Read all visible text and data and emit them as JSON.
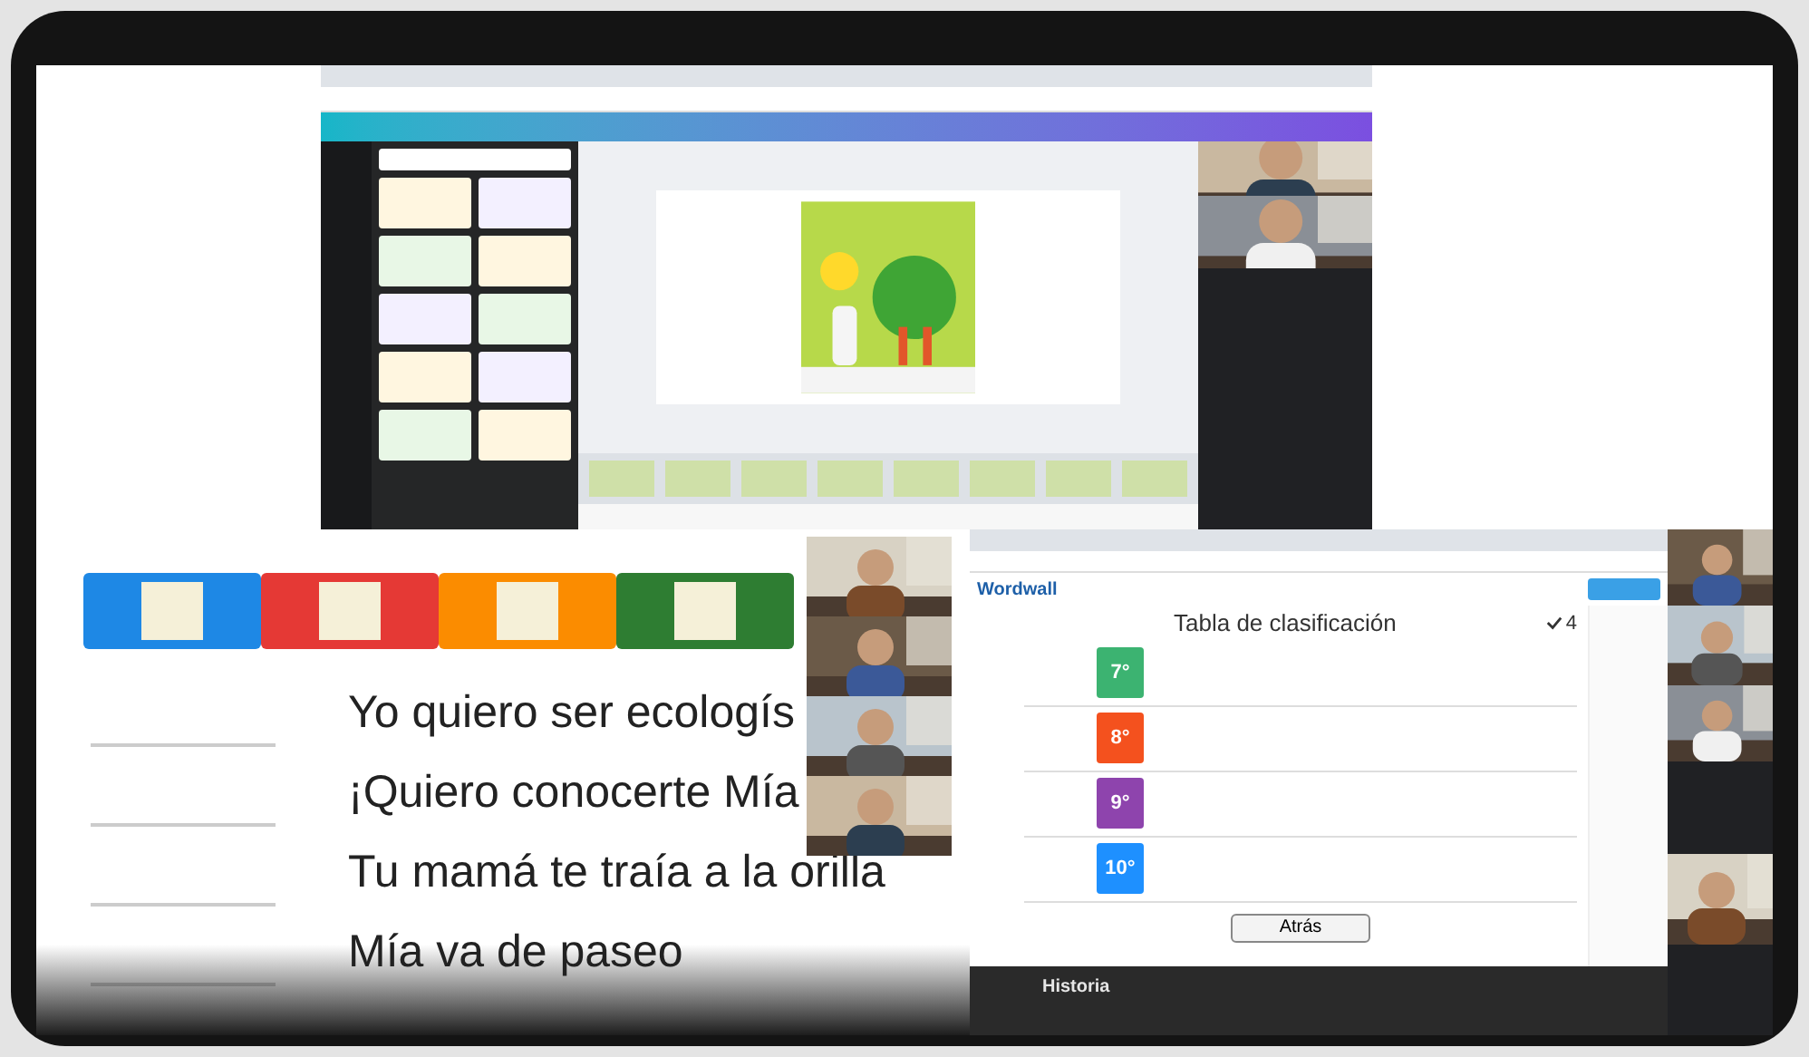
{
  "lesson_slide": {
    "cards": [
      {
        "color": "#1e88e5"
      },
      {
        "color": "#e53935"
      },
      {
        "color": "#fb8c00"
      },
      {
        "color": "#2e7d32"
      }
    ],
    "phrases": [
      "Yo quiero ser ecologís",
      "¡Quiero conocerte Mía",
      "Tu mamá te traía a la orilla",
      "Mía va de paseo"
    ]
  },
  "wordwall": {
    "brand": "Wordwall",
    "title": "Tabla de clasificación",
    "score": "4",
    "ranks": [
      {
        "label": "7°",
        "color": "#3cb371"
      },
      {
        "label": "8°",
        "color": "#f4511e"
      },
      {
        "label": "9°",
        "color": "#8e44ad"
      },
      {
        "label": "10°",
        "color": "#1e90ff"
      }
    ],
    "back_button": "Atrás",
    "section": "Historia"
  }
}
